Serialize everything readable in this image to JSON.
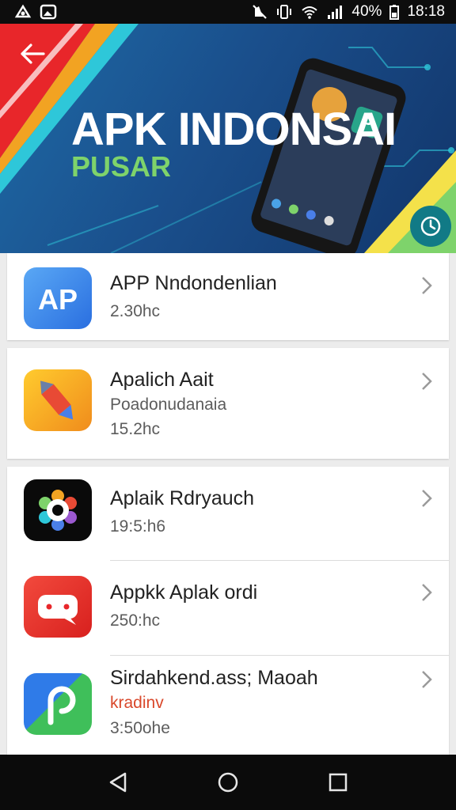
{
  "status_bar": {
    "battery_percent": "40%",
    "time": "18:18",
    "icons": [
      "app-notification-icon",
      "photo-notification-icon",
      "mute-icon",
      "vibrate-icon",
      "wifi-icon",
      "signal-icon",
      "battery-icon"
    ]
  },
  "banner": {
    "title": "APK INDONSAI",
    "subtitle": "PUSAR",
    "colors": {
      "background": "#1a4f8c",
      "title": "#ffffff",
      "subtitle": "#7ed36b",
      "accent_red": "#e8262a",
      "accent_cyan": "#2ec7d9"
    }
  },
  "apps": [
    {
      "name": "APP Nndondenlian",
      "lines": [
        "2.30hc"
      ],
      "icon": "ap-logo-icon"
    },
    {
      "name": "Apalich Aait",
      "lines": [
        "Poadonudanaia",
        "15.2hc"
      ],
      "icon": "pencil-rocket-icon"
    },
    {
      "name": "Aplaik Rdryauch",
      "lines": [
        "19:5:h6"
      ],
      "icon": "gear-flower-icon"
    },
    {
      "name": "Appkk Aplak ordi",
      "lines": [
        "250:hc"
      ],
      "icon": "chat-bubble-icon"
    },
    {
      "name": "Sirdahkend.ass; Maoah",
      "lines": [
        "kradinv",
        "3:50ohe"
      ],
      "icon": "p-letter-icon"
    }
  ],
  "nav": {
    "icons": [
      "back-triangle-icon",
      "home-circle-icon",
      "recents-square-icon"
    ]
  }
}
